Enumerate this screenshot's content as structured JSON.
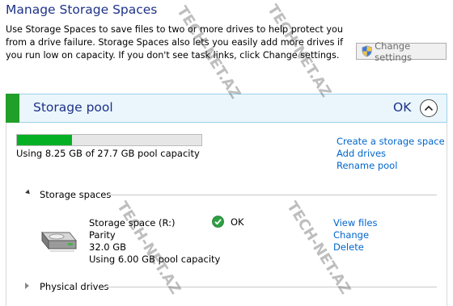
{
  "header": {
    "title": "Manage Storage Spaces",
    "description": "Use Storage Spaces to save files to two or more drives to help protect you from a drive failure. Storage Spaces also lets you easily add more drives if you run low on capacity. If you don't see task links, click Change settings.",
    "change_settings_label": "Change settings"
  },
  "pool": {
    "title": "Storage pool",
    "status": "OK",
    "capacity_used_fraction": 0.298,
    "capacity_text": "Using 8.25 GB of 27.7 GB pool capacity",
    "links": {
      "create": "Create a storage space",
      "add": "Add drives",
      "rename": "Rename pool"
    }
  },
  "spaces_section": {
    "label": "Storage spaces",
    "space": {
      "name": "Storage space (R:)",
      "resiliency": "Parity",
      "size": "32.0 GB",
      "usage": "Using 6.00 GB pool capacity",
      "status": "OK",
      "links": {
        "view": "View files",
        "change": "Change",
        "delete": "Delete"
      }
    }
  },
  "physical_section": {
    "label": "Physical drives"
  },
  "watermark": "TECH-NET.AZ",
  "colors": {
    "title_blue": "#1e3287",
    "link_blue": "#0066cc",
    "pool_accent_green": "#20a02a",
    "progress_green": "#06b025"
  }
}
